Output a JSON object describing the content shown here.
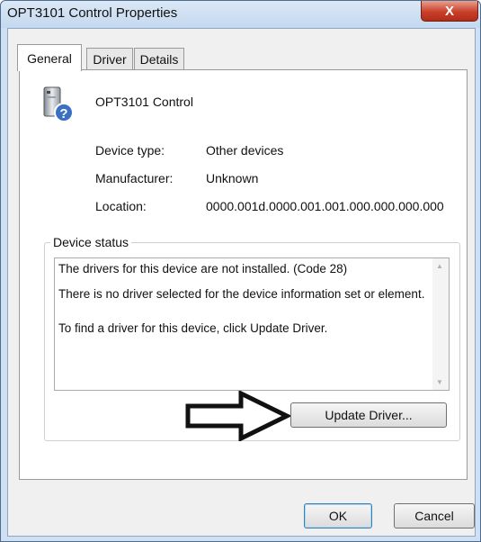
{
  "window": {
    "title": "OPT3101 Control Properties",
    "close_glyph": "X"
  },
  "tabs": [
    {
      "label": "General",
      "active": true
    },
    {
      "label": "Driver",
      "active": false
    },
    {
      "label": "Details",
      "active": false
    }
  ],
  "device": {
    "name": "OPT3101 Control",
    "icon": "unknown-device-icon",
    "properties": [
      {
        "label": "Device type:",
        "value": "Other devices"
      },
      {
        "label": "Manufacturer:",
        "value": "Unknown"
      },
      {
        "label": "Location:",
        "value": "0000.001d.0000.001.001.000.000.000.000"
      }
    ]
  },
  "status": {
    "legend": "Device status",
    "lines": [
      "The drivers for this device are not installed. (Code 28)",
      "There is no driver selected for the device information set or element.",
      "To find a driver for this device, click Update Driver."
    ]
  },
  "buttons": {
    "update_driver": "Update Driver...",
    "ok": "OK",
    "cancel": "Cancel"
  },
  "annotation": {
    "icon": "right-arrow-icon"
  },
  "colors": {
    "close_button": "#c9402a",
    "title_bar": "#cfe0f3",
    "help_badge": "#3a6fc4"
  }
}
